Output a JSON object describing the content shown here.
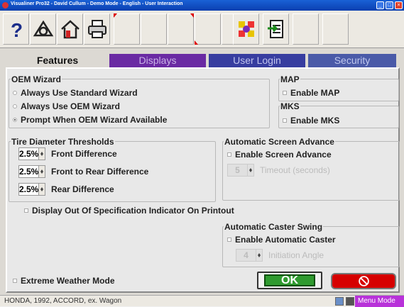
{
  "window": {
    "title": "Visualiner Pro32 - David Cullum - Demo Mode - English - User Interaction",
    "title_color": "#0a3fb0"
  },
  "toolbar": {
    "buttons": [
      "help-icon",
      "alignment-icon",
      "home-icon",
      "print-icon",
      "blank",
      "blank",
      "blank",
      "toggle-icon",
      "gears-icon",
      "checklist-icon",
      "blank",
      "blank"
    ]
  },
  "tabs": [
    {
      "label": "Features",
      "active": true,
      "color": "#dcd9d3"
    },
    {
      "label": "Displays",
      "active": false,
      "color": "#6a2aa3"
    },
    {
      "label": "User Login",
      "active": false,
      "color": "#373da0"
    },
    {
      "label": "Security",
      "active": false,
      "color": "#4a5aa8"
    }
  ],
  "oem_wizard": {
    "title": "OEM Wizard",
    "options": [
      "Always Use Standard Wizard",
      "Always Use OEM Wizard",
      "Prompt When OEM Wizard Available"
    ],
    "selected_index": 2
  },
  "map": {
    "title": "MAP",
    "label": "Enable MAP",
    "checked": true
  },
  "mks": {
    "title": "MKS",
    "label": "Enable MKS",
    "checked": false
  },
  "tire": {
    "title": "Tire Diameter Thresholds",
    "rows": [
      {
        "value": "2.5%",
        "label": "Front Difference"
      },
      {
        "value": "2.5%",
        "label": "Front to Rear Difference"
      },
      {
        "value": "2.5%",
        "label": "Rear Difference"
      }
    ]
  },
  "screen_advance": {
    "title": "Automatic Screen Advance",
    "enable_label": "Enable Screen Advance",
    "timeout_value": "5",
    "timeout_label": "Timeout (seconds)"
  },
  "display_out_of_spec": {
    "label": "Display Out Of Specification Indicator On Printout",
    "checked": false
  },
  "caster": {
    "title": "Automatic Caster Swing",
    "enable_label": "Enable Automatic Caster",
    "angle_value": "4",
    "angle_label": "Initiation Angle"
  },
  "extreme_weather": {
    "label": "Extreme Weather Mode",
    "checked": false
  },
  "buttons": {
    "ok_label": "OK",
    "cancel_icon": "no-entry-icon",
    "ok_color": "#2f9a2f",
    "cancel_color": "#d60000"
  },
  "status": {
    "vehicle": "HONDA, 1992, ACCORD, ex. Wagon",
    "mode": "Menu Mode",
    "mode_color": "#b832d9"
  }
}
